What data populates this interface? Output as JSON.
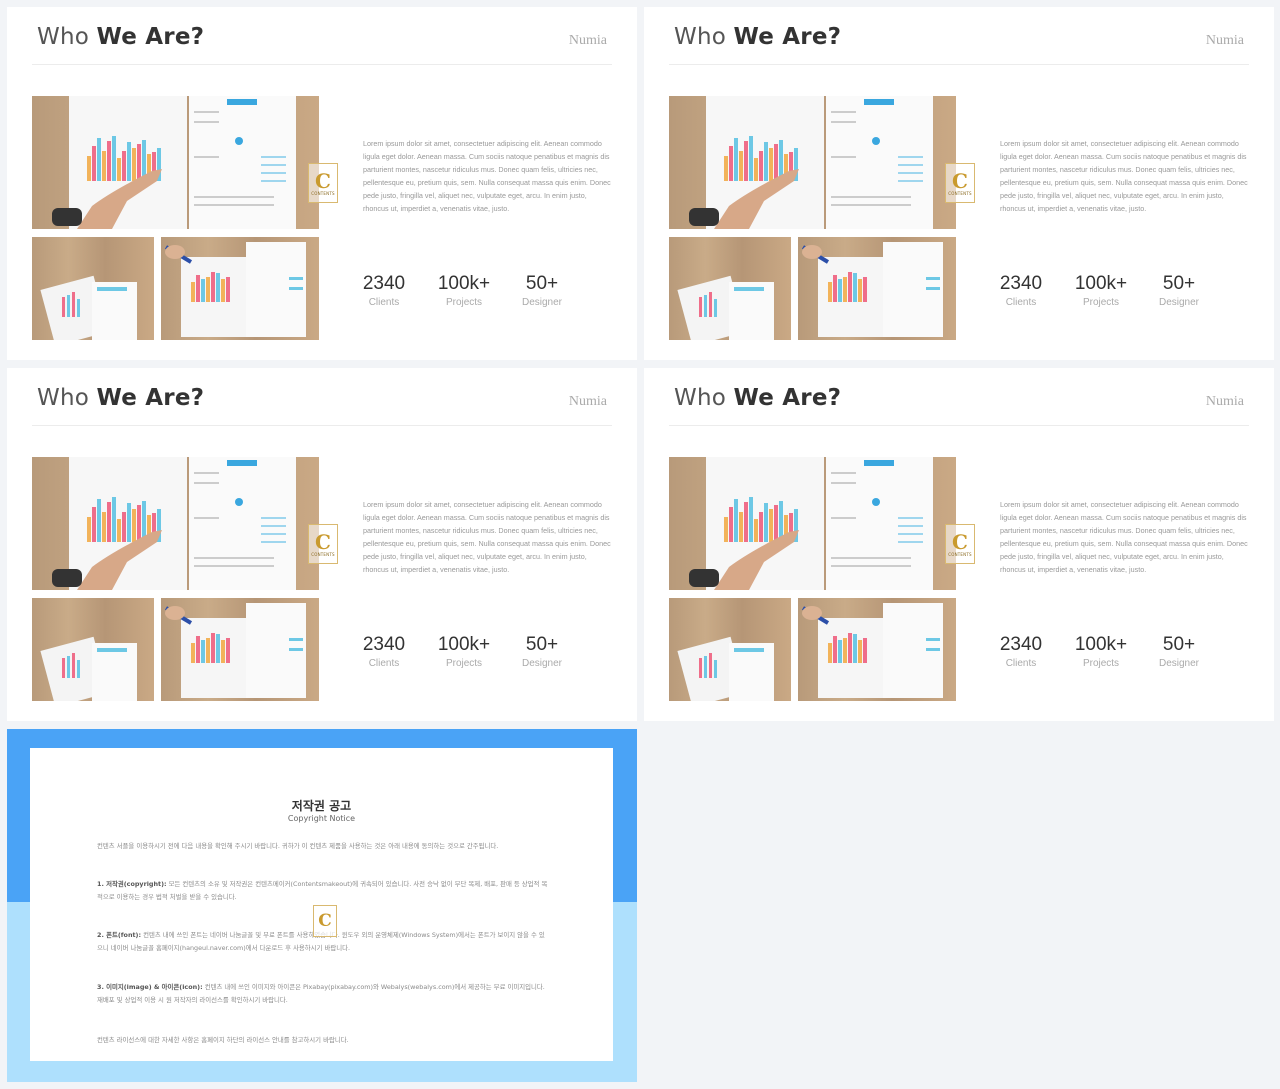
{
  "slides": [
    {
      "title_light": "Who",
      "title_bold": "We Are?",
      "brand": "Numia",
      "body": "Lorem ipsum dolor sit amet, consectetuer adipiscing elit. Aenean commodo ligula eget dolor. Aenean massa. Cum sociis natoque penatibus et magnis dis parturient montes, nascetur ridiculus mus. Donec quam felis, ultricies nec, pellentesque eu, pretium quis, sem. Nulla consequat massa quis enim. Donec pede justo, fringilla vel, aliquet nec, vulputate eget, arcu. In enim justo, rhoncus ut, imperdiet a, venenatis vitae, justo.",
      "stats": [
        {
          "value": "2340",
          "label": "Clients"
        },
        {
          "value": "100k+",
          "label": "Projects"
        },
        {
          "value": "50+",
          "label": "Designer"
        }
      ]
    },
    {
      "title_light": "Who",
      "title_bold": "We Are?",
      "brand": "Numia",
      "body": "Lorem ipsum dolor sit amet, consectetuer adipiscing elit. Aenean commodo ligula eget dolor. Aenean massa. Cum sociis natoque penatibus et magnis dis parturient montes, nascetur ridiculus mus. Donec quam felis, ultricies nec, pellentesque eu, pretium quis, sem. Nulla consequat massa quis enim. Donec pede justo, fringilla vel, aliquet nec, vulputate eget, arcu. In enim justo, rhoncus ut, imperdiet a, venenatis vitae, justo.",
      "stats": [
        {
          "value": "2340",
          "label": "Clients"
        },
        {
          "value": "100k+",
          "label": "Projects"
        },
        {
          "value": "50+",
          "label": "Designer"
        }
      ]
    },
    {
      "title_light": "Who",
      "title_bold": "We Are?",
      "brand": "Numia",
      "body": "Lorem ipsum dolor sit amet, consectetuer adipiscing elit. Aenean commodo ligula eget dolor. Aenean massa. Cum sociis natoque penatibus et magnis dis parturient montes, nascetur ridiculus mus. Donec quam felis, ultricies nec, pellentesque eu, pretium quis, sem. Nulla consequat massa quis enim. Donec pede justo, fringilla vel, aliquet nec, vulputate eget, arcu. In enim justo, rhoncus ut, imperdiet a, venenatis vitae, justo.",
      "stats": [
        {
          "value": "2340",
          "label": "Clients"
        },
        {
          "value": "100k+",
          "label": "Projects"
        },
        {
          "value": "50+",
          "label": "Designer"
        }
      ]
    },
    {
      "title_light": "Who",
      "title_bold": "We Are?",
      "brand": "Numia",
      "body": "Lorem ipsum dolor sit amet, consectetuer adipiscing elit. Aenean commodo ligula eget dolor. Aenean massa. Cum sociis natoque penatibus et magnis dis parturient montes, nascetur ridiculus mus. Donec quam felis, ultricies nec, pellentesque eu, pretium quis, sem. Nulla consequat massa quis enim. Donec pede justo, fringilla vel, aliquet nec, vulputate eget, arcu. In enim justo, rhoncus ut, imperdiet a, venenatis vitae, justo.",
      "stats": [
        {
          "value": "2340",
          "label": "Clients"
        },
        {
          "value": "100k+",
          "label": "Projects"
        },
        {
          "value": "50+",
          "label": "Designer"
        }
      ]
    }
  ],
  "watermark": {
    "letter": "C",
    "text": "CONTENTS"
  },
  "notice": {
    "title": "저작권 공고",
    "subtitle": "Copyright Notice",
    "p1": "컨텐츠 서플을 이용하시기 전에 다음 내용을 확인해 주시기 바랍니다. 귀하가 이 컨텐츠 제품을 사용하는 것은 아래 내용에 동의하는 것으로 간주됩니다.",
    "p2_head": "1. 저작권(copyright):",
    "p2": "모든 컨텐츠의 소유 및 저작권은 컨텐츠메이커(Contentsmakeout)에 귀속되어 있습니다. 사전 승낙 없이 무단 복제, 배포, 판매 등 상업적 목적으로 이용하는 경우 법적 처벌을 받을 수 있습니다.",
    "p3_head": "2. 폰트(font):",
    "p3": "컨텐츠 내에 쓰인 폰트는 네이버 나눔글꼴 및 무료 폰트를 사용하였습니다. 윈도우 외의 운영체제(Windows System)에서는 폰트가 보이지 않을 수 있으니 네이버 나눔글꼴 홈페이지(hangeul.naver.com)에서 다운로드 후 사용하시기 바랍니다.",
    "p4_head": "3. 이미지(image) & 아이콘(icon):",
    "p4": "컨텐츠 내에 쓰인 이미지와 아이콘은 Pixabay(pixabay.com)와 Webalys(webalys.com)에서 제공하는 무료 이미지입니다. 재배포 및 상업적 이용 시 원 저작자의 라이선스를 확인하시기 바랍니다.",
    "p5": "컨텐츠 라이선스에 대한 자세한 사항은 홈페이지 하단의 라이선스 안내를 참고하시기 바랍니다."
  }
}
